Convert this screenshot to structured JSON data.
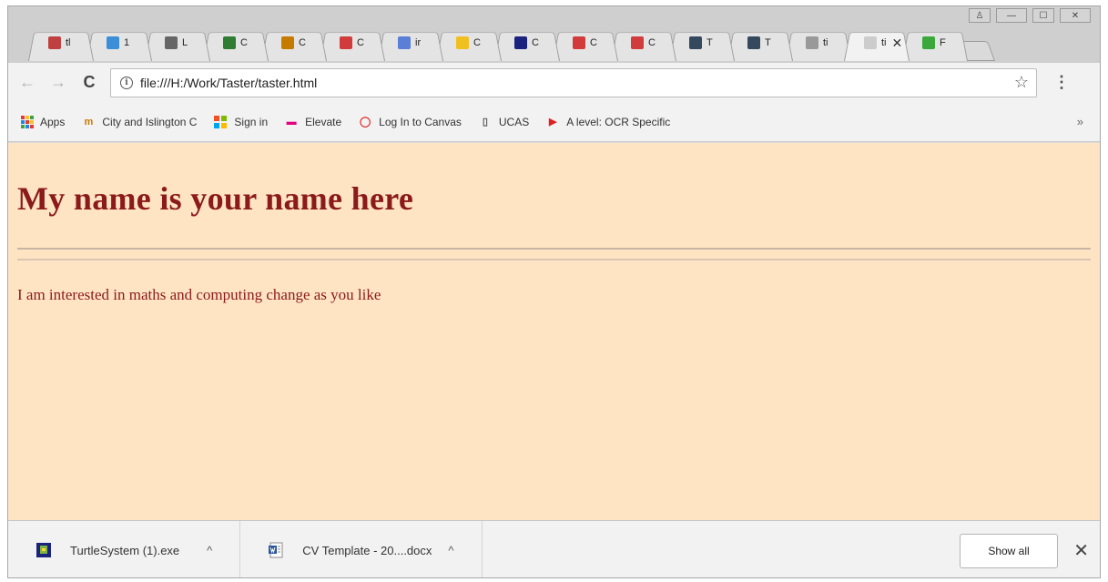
{
  "window": {
    "controls": {
      "user": "♙",
      "minimize": "—",
      "maximize": "☐",
      "close": "✕"
    }
  },
  "tabs": [
    {
      "label": "tl",
      "favicon": "#c04040"
    },
    {
      "label": "1",
      "favicon": "#3b8ed8"
    },
    {
      "label": "L",
      "favicon": "#666666"
    },
    {
      "label": "C",
      "favicon": "#2e7d32"
    },
    {
      "label": "C",
      "favicon": "#c67a00"
    },
    {
      "label": "C",
      "favicon": "#d23b3b"
    },
    {
      "label": "ir",
      "favicon": "#5b7fd6"
    },
    {
      "label": "C",
      "favicon": "#f0c020"
    },
    {
      "label": "C",
      "favicon": "#1a237e"
    },
    {
      "label": "C",
      "favicon": "#d23b3b"
    },
    {
      "label": "C",
      "favicon": "#d23b3b"
    },
    {
      "label": "T",
      "favicon": "#34495e"
    },
    {
      "label": "T",
      "favicon": "#34495e"
    },
    {
      "label": "ti",
      "favicon": "#999999"
    },
    {
      "label": "ti",
      "favicon": "#cccccc",
      "active": true,
      "close": "✕"
    },
    {
      "label": "F",
      "favicon": "#3aa83a"
    }
  ],
  "toolbar": {
    "back": "←",
    "forward": "→",
    "reload": "C",
    "url": "file:///H:/Work/Taster/taster.html",
    "info": "i",
    "star": "☆",
    "menu": "⋮"
  },
  "bookmarks": {
    "apps": "Apps",
    "items": [
      {
        "label": "City and Islington C",
        "icon": "m",
        "color": "#c67a00"
      },
      {
        "label": "Sign in",
        "icon": "ms",
        "color": "#f25022"
      },
      {
        "label": "Elevate",
        "icon": "▬",
        "color": "#e6007e"
      },
      {
        "label": "Log In to Canvas",
        "icon": "◯",
        "color": "#e02020"
      },
      {
        "label": "UCAS",
        "icon": "▯",
        "color": "#555555"
      },
      {
        "label": "A level: OCR Specific",
        "icon": "▶",
        "color": "#e02020"
      }
    ],
    "overflow": "»"
  },
  "page": {
    "background": "#ffe4c4",
    "text_color": "#8b1a1a",
    "heading": "My name is your name here",
    "paragraph": "I am interested in maths and computing change as you like"
  },
  "downloads": {
    "items": [
      {
        "name": "TurtleSystem (1).exe",
        "chevron": "^"
      },
      {
        "name": "CV Template - 20....docx",
        "chevron": "^"
      }
    ],
    "show_all": "Show all",
    "close": "✕"
  }
}
